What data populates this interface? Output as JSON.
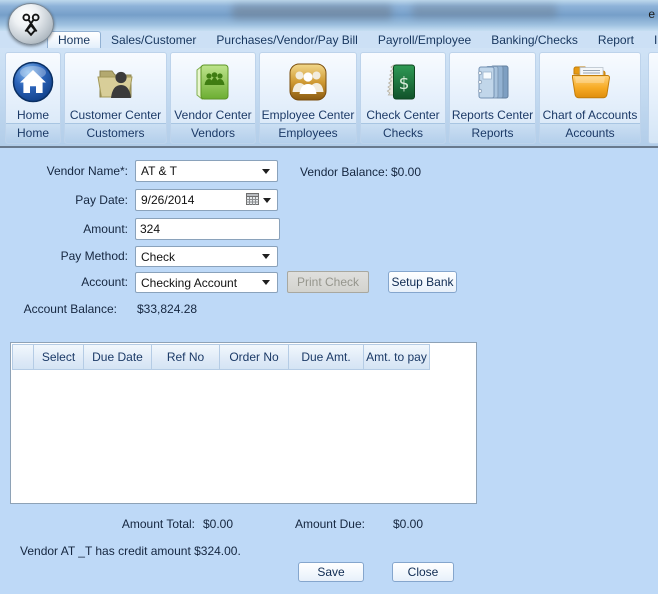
{
  "window": {
    "title_fragment": "e"
  },
  "tabs": [
    {
      "label": "Home",
      "active": true
    },
    {
      "label": "Sales/Customer",
      "active": false
    },
    {
      "label": "Purchases/Vendor/Pay Bill",
      "active": false
    },
    {
      "label": "Payroll/Employee",
      "active": false
    },
    {
      "label": "Banking/Checks",
      "active": false
    },
    {
      "label": "Report",
      "active": false
    },
    {
      "label": "Import/Export",
      "active": false
    }
  ],
  "ribbon": {
    "groups": [
      {
        "button": "Home",
        "group": "Home",
        "icon": "home-icon"
      },
      {
        "button": "Customer Center",
        "group": "Customers",
        "icon": "customer-folder-icon"
      },
      {
        "button": "Vendor Center",
        "group": "Vendors",
        "icon": "vendor-book-icon"
      },
      {
        "button": "Employee Center",
        "group": "Employees",
        "icon": "employees-icon"
      },
      {
        "button": "Check Center",
        "group": "Checks",
        "icon": "checkbook-icon"
      },
      {
        "button": "Reports Center",
        "group": "Reports",
        "icon": "reports-icon"
      },
      {
        "button": "Chart of Accounts",
        "group": "Accounts",
        "icon": "accounts-folder-icon"
      }
    ]
  },
  "form": {
    "vendor_name_label": "Vendor Name*:",
    "vendor_name_value": "AT & T",
    "vendor_balance_label": "Vendor Balance:",
    "vendor_balance_value": "$0.00",
    "pay_date_label": "Pay Date:",
    "pay_date_value": "9/26/2014",
    "amount_label": "Amount:",
    "amount_value": "324",
    "pay_method_label": "Pay Method:",
    "pay_method_value": "Check",
    "account_label": "Account:",
    "account_value": "Checking Account",
    "print_check_label": "Print Check",
    "setup_bank_label": "Setup Bank",
    "account_balance_label": "Account Balance:",
    "account_balance_value": "$33,824.28"
  },
  "table": {
    "columns": [
      "",
      "Select",
      "Due Date",
      "Ref No",
      "Order No",
      "Due Amt.",
      "Amt. to pay"
    ],
    "rows": []
  },
  "totals": {
    "amount_total_label": "Amount Total:",
    "amount_total_value": "$0.00",
    "amount_due_label": "Amount Due:",
    "amount_due_value": "$0.00"
  },
  "notice": {
    "text": "Vendor AT _T has credit amount $324.00."
  },
  "actions": {
    "save_label": "Save",
    "close_label": "Close"
  },
  "colors": {
    "titlebar_blue": "#769fc9",
    "content_bg": "#bed9f7",
    "accent_navy": "#1c3a67",
    "table_header_bg": "#dfeaf7",
    "disabled_button_bg": "#d3d3ce"
  }
}
